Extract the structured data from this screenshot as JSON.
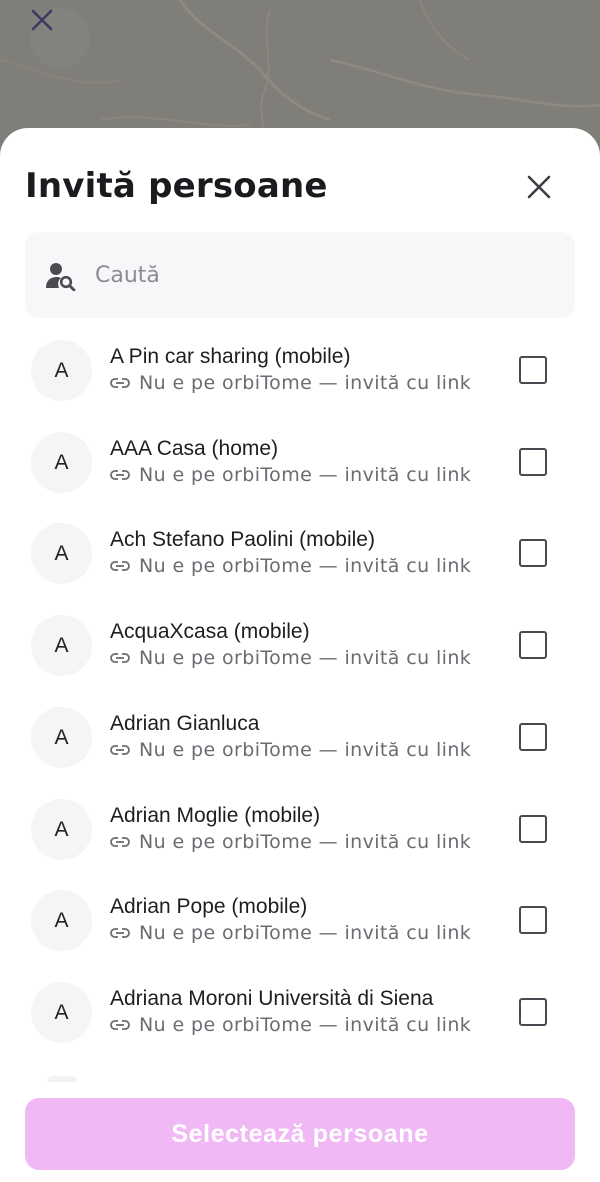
{
  "map": {
    "close_icon": "close-icon"
  },
  "sheet": {
    "title": "Invită persoane",
    "close_icon": "close-icon"
  },
  "search": {
    "placeholder": "Caută",
    "icon": "person-search-icon",
    "value": ""
  },
  "contacts": [
    {
      "initial": "A",
      "name": "A Pin car sharing (mobile)",
      "status": "Nu e pe orbiTome — invită cu link",
      "checked": false
    },
    {
      "initial": "A",
      "name": "AAA Casa (home)",
      "status": "Nu e pe orbiTome — invită cu link",
      "checked": false
    },
    {
      "initial": "A",
      "name": "Ach Stefano Paolini (mobile)",
      "status": "Nu e pe orbiTome — invită cu link",
      "checked": false
    },
    {
      "initial": "A",
      "name": "AcquaXcasa (mobile)",
      "status": "Nu e pe orbiTome — invită cu link",
      "checked": false
    },
    {
      "initial": "A",
      "name": "Adrian Gianluca",
      "status": "Nu e pe orbiTome — invită cu link",
      "checked": false
    },
    {
      "initial": "A",
      "name": "Adrian Moglie (mobile)",
      "status": "Nu e pe orbiTome — invită cu link",
      "checked": false
    },
    {
      "initial": "A",
      "name": "Adrian Pope (mobile)",
      "status": "Nu e pe orbiTome — invită cu link",
      "checked": false
    },
    {
      "initial": "A",
      "name": "Adriana Moroni Università di Siena",
      "status": "Nu e pe orbiTome — invită cu link",
      "checked": false
    }
  ],
  "footer": {
    "button_label": "Selectează persoane",
    "button_color": "#f0b8f5"
  },
  "colors": {
    "accent": "#f0b8f5",
    "title": "#1b1b1f",
    "subtext": "#6d6b72"
  }
}
